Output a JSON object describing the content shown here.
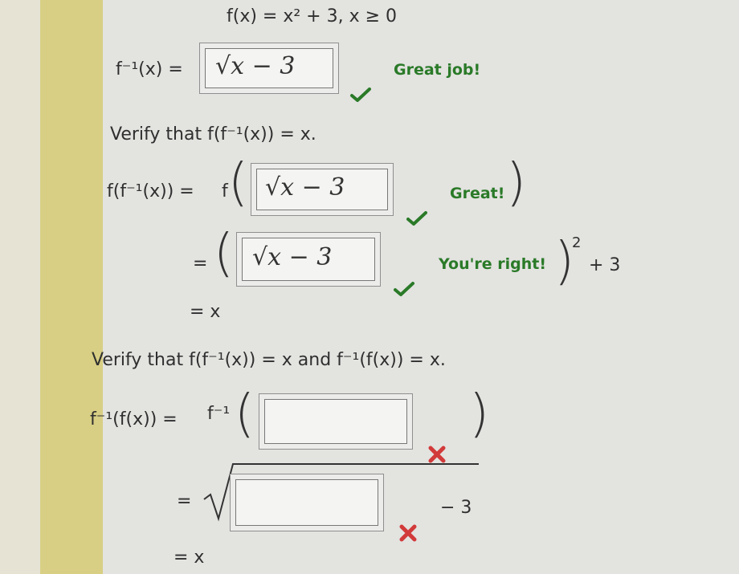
{
  "header": {
    "function_def": "f(x) = x² + 3, x ≥ 0"
  },
  "inverse_row": {
    "label": "f⁻¹(x) =",
    "answer": "√x − 3",
    "feedback": "Great job!"
  },
  "verify1": {
    "instruction": "Verify that f(f⁻¹(x)) = x.",
    "lhs": "f(f⁻¹(x)) =",
    "f_prefix": "f",
    "answer1": "√x − 3",
    "feedback1": "Great!",
    "eq2": "=",
    "answer2": "√x − 3",
    "feedback2": "You're right!",
    "exponent": "2",
    "plus_three": "+ 3",
    "result": "= x"
  },
  "verify2": {
    "instruction": "Verify that f(f⁻¹(x)) = x and f⁻¹(f(x)) = x.",
    "lhs": "f⁻¹(f(x)) =",
    "finv_prefix": "f⁻¹",
    "input1": "",
    "eq2": "=",
    "input2": "",
    "minus_three": "− 3",
    "result": "= x"
  },
  "colors": {
    "correct": "#2a7a28",
    "incorrect": "#d23a3a"
  },
  "icons": {
    "correct": "check-icon",
    "incorrect": "x-icon"
  }
}
